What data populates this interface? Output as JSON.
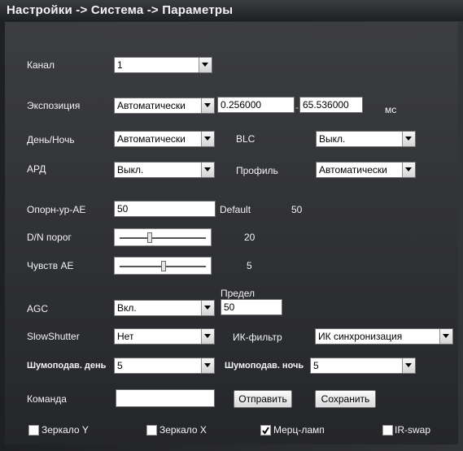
{
  "title": "Настройки -> Система -> Параметры",
  "channel": {
    "label": "Канал",
    "value": "1"
  },
  "exposure": {
    "label": "Экспозиция",
    "mode": "Автоматически",
    "min": "0.256000",
    "dash": "-",
    "max": "65.536000",
    "unit": "мс"
  },
  "daynight": {
    "label": "День/Ночь",
    "value": "Автоматически"
  },
  "blc": {
    "label": "BLC",
    "value": "Выкл."
  },
  "ard": {
    "label": "АРД",
    "value": "Выкл."
  },
  "profile": {
    "label": "Профиль",
    "value": "Автоматически"
  },
  "ae_ref": {
    "label": "Опорн-ур-AE",
    "value": "50",
    "default_label": "Default",
    "default_value": "50"
  },
  "dn_threshold": {
    "label": "D/N порог",
    "value": "20",
    "level": 20
  },
  "ae_sens": {
    "label": "Чувств AE",
    "value": "5",
    "level": 5
  },
  "agc": {
    "label": "AGC",
    "value": "Вкл.",
    "limit_label": "Предел",
    "limit_value": "50"
  },
  "slow_shutter": {
    "label": "SlowShutter",
    "value": "Нет"
  },
  "ir_filter": {
    "label": "ИК-фильтр",
    "value": "ИК синхронизация"
  },
  "nr_day": {
    "label": "Шумоподав. день",
    "value": "5"
  },
  "nr_night": {
    "label": "Шумоподав. ночь",
    "value": "5"
  },
  "command": {
    "label": "Команда",
    "value": "",
    "send_label": "Отправить",
    "save_label": "Сохранить"
  },
  "checkboxes": [
    {
      "label": "Зеркало Y",
      "checked": false
    },
    {
      "label": "Зеркало X",
      "checked": false
    },
    {
      "label": "Мерц-ламп",
      "checked": true
    },
    {
      "label": "IR-swap",
      "checked": false
    }
  ]
}
